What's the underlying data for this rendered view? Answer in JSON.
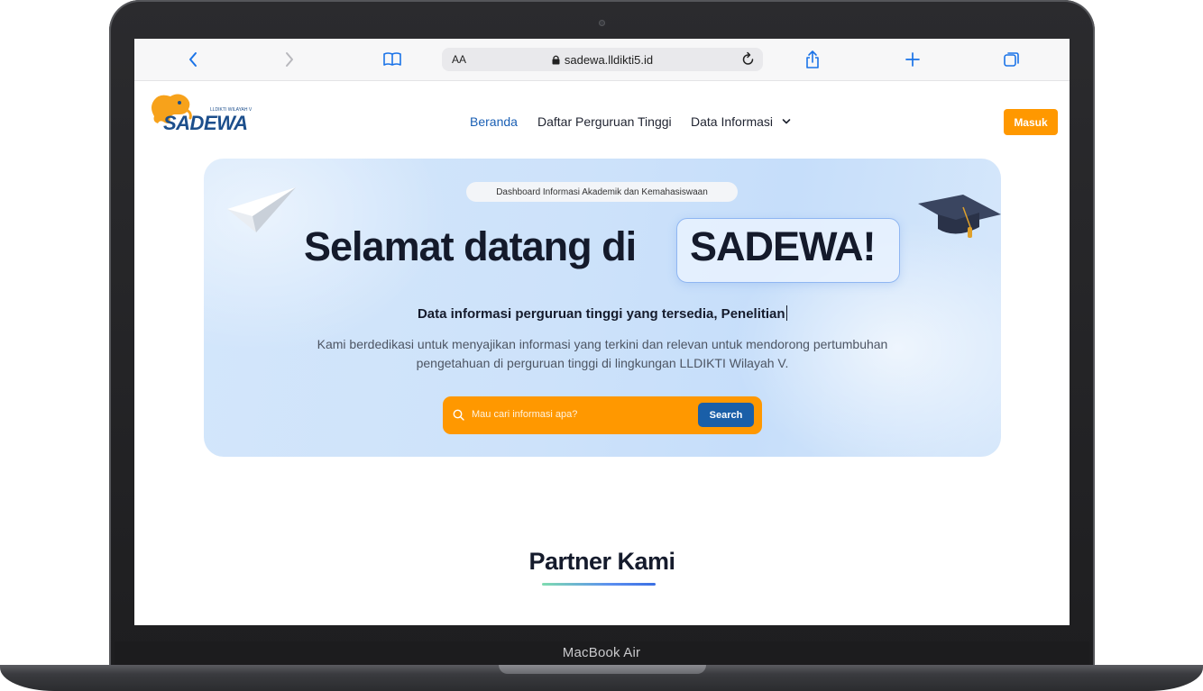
{
  "device": {
    "label": "MacBook Air"
  },
  "browser": {
    "text_size_label": "AA",
    "url": "sadewa.lldikti5.id"
  },
  "site": {
    "logo": {
      "name": "SADEWA",
      "tagline": "LLDIKTI WILAYAH V"
    },
    "nav": {
      "home": "Beranda",
      "universities": "Daftar Perguruan Tinggi",
      "info": "Data Informasi"
    },
    "login_label": "Masuk",
    "accent_color": "#ff9800",
    "primary_color": "#1a5fa8"
  },
  "hero": {
    "badge": "Dashboard Informasi Akademik dan Kemahasiswaan",
    "headline_prefix": "Selamat datang di",
    "headline_highlight": "SADEWA!",
    "subheading": "Data informasi perguruan tinggi yang tersedia, Penelitian",
    "description": "Kami berdedikasi untuk menyajikan informasi yang terkini dan relevan untuk mendorong pertumbuhan pengetahuan di perguruan tinggi di lingkungan LLDIKTI Wilayah V.",
    "search_placeholder": "Mau cari informasi apa?",
    "search_button": "Search"
  },
  "partner": {
    "title": "Partner Kami"
  }
}
